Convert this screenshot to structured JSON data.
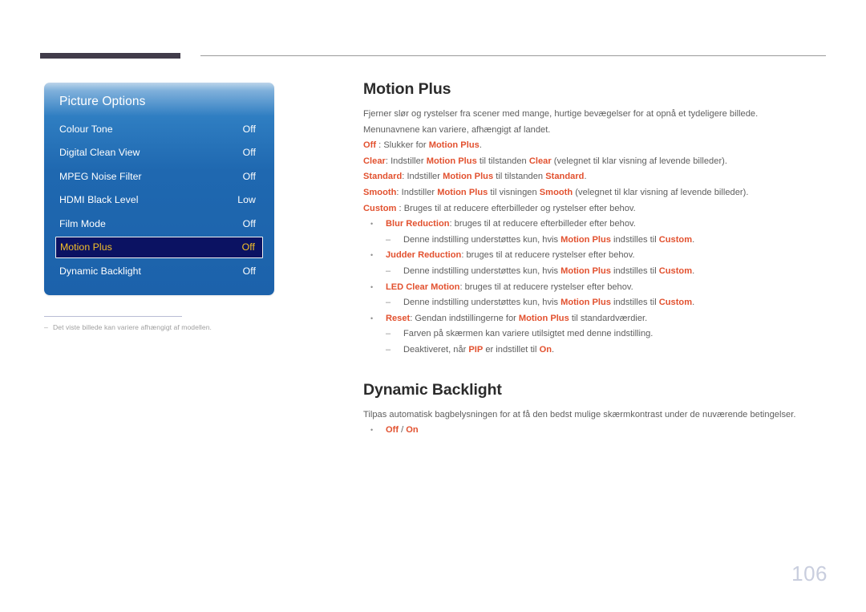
{
  "page": {
    "number": "106"
  },
  "osd": {
    "title": "Picture Options",
    "rows": [
      {
        "label": "Colour Tone",
        "value": "Off",
        "selected": false
      },
      {
        "label": "Digital Clean View",
        "value": "Off",
        "selected": false
      },
      {
        "label": "MPEG Noise Filter",
        "value": "Off",
        "selected": false
      },
      {
        "label": "HDMI Black Level",
        "value": "Low",
        "selected": false
      },
      {
        "label": "Film Mode",
        "value": "Off",
        "selected": false
      },
      {
        "label": "Motion Plus",
        "value": "Off",
        "selected": true
      },
      {
        "label": "Dynamic Backlight",
        "value": "Off",
        "selected": false
      }
    ],
    "accent_selected_text": "#f5c028",
    "accent_selected_bg": "#0b1262",
    "panel_blue": "#1f68b0"
  },
  "footnote": {
    "dash": "–",
    "text": "Det viste billede kan variere afhængigt af modellen."
  },
  "sections": [
    {
      "heading": "Motion Plus",
      "paragraphs": [
        {
          "segments": [
            {
              "t": "Fjerner slør og rystelser fra scener med mange, hurtige bevægelser for at opnå et tydeligere billede.",
              "s": "plain"
            }
          ]
        },
        {
          "segments": [
            {
              "t": "Menunavnene kan variere, afhængigt af landet.",
              "s": "plain"
            }
          ]
        },
        {
          "segments": [
            {
              "t": "Off",
              "s": "accent"
            },
            {
              "t": " : Slukker for ",
              "s": "plain"
            },
            {
              "t": "Motion Plus",
              "s": "accent"
            },
            {
              "t": ".",
              "s": "plain"
            }
          ]
        },
        {
          "segments": [
            {
              "t": "Clear",
              "s": "accent"
            },
            {
              "t": ": Indstiller ",
              "s": "plain"
            },
            {
              "t": "Motion Plus",
              "s": "accent"
            },
            {
              "t": " til tilstanden ",
              "s": "plain"
            },
            {
              "t": "Clear",
              "s": "accent"
            },
            {
              "t": " (velegnet til klar visning af levende billeder).",
              "s": "plain"
            }
          ]
        },
        {
          "segments": [
            {
              "t": "Standard",
              "s": "accent"
            },
            {
              "t": ": Indstiller ",
              "s": "plain"
            },
            {
              "t": "Motion Plus",
              "s": "accent"
            },
            {
              "t": " til tilstanden ",
              "s": "plain"
            },
            {
              "t": "Standard",
              "s": "accent"
            },
            {
              "t": ".",
              "s": "plain"
            }
          ]
        },
        {
          "segments": [
            {
              "t": "Smooth",
              "s": "accent"
            },
            {
              "t": ": Indstiller ",
              "s": "plain"
            },
            {
              "t": "Motion Plus",
              "s": "accent"
            },
            {
              "t": " til visningen ",
              "s": "plain"
            },
            {
              "t": "Smooth",
              "s": "accent"
            },
            {
              "t": " (velegnet til klar visning af levende billeder).",
              "s": "plain"
            }
          ]
        },
        {
          "segments": [
            {
              "t": "Custom",
              "s": "accent"
            },
            {
              "t": " : Bruges til at reducere efterbilleder og rystelser efter behov.",
              "s": "plain"
            }
          ]
        }
      ],
      "bullets": [
        {
          "level": 1,
          "segments": [
            {
              "t": "Blur Reduction",
              "s": "accent"
            },
            {
              "t": ": bruges til at reducere efterbilleder efter behov.",
              "s": "plain"
            }
          ]
        },
        {
          "level": 2,
          "segments": [
            {
              "t": "Denne indstilling understøttes kun, hvis ",
              "s": "plain"
            },
            {
              "t": "Motion Plus",
              "s": "accent"
            },
            {
              "t": " indstilles til ",
              "s": "plain"
            },
            {
              "t": "Custom",
              "s": "accent"
            },
            {
              "t": ".",
              "s": "plain"
            }
          ]
        },
        {
          "level": 1,
          "segments": [
            {
              "t": "Judder Reduction",
              "s": "accent"
            },
            {
              "t": ": bruges til at reducere rystelser efter behov.",
              "s": "plain"
            }
          ]
        },
        {
          "level": 2,
          "segments": [
            {
              "t": "Denne indstilling understøttes kun, hvis ",
              "s": "plain"
            },
            {
              "t": "Motion Plus",
              "s": "accent"
            },
            {
              "t": " indstilles til ",
              "s": "plain"
            },
            {
              "t": "Custom",
              "s": "accent"
            },
            {
              "t": ".",
              "s": "plain"
            }
          ]
        },
        {
          "level": 1,
          "segments": [
            {
              "t": "LED Clear Motion",
              "s": "accent"
            },
            {
              "t": ": bruges til at reducere rystelser efter behov.",
              "s": "plain"
            }
          ]
        },
        {
          "level": 2,
          "segments": [
            {
              "t": "Denne indstilling understøttes kun, hvis ",
              "s": "plain"
            },
            {
              "t": "Motion Plus",
              "s": "accent"
            },
            {
              "t": " indstilles til ",
              "s": "plain"
            },
            {
              "t": "Custom",
              "s": "accent"
            },
            {
              "t": ".",
              "s": "plain"
            }
          ]
        },
        {
          "level": 1,
          "segments": [
            {
              "t": "Reset",
              "s": "accent"
            },
            {
              "t": ": Gendan indstillingerne for ",
              "s": "plain"
            },
            {
              "t": "Motion Plus",
              "s": "accent"
            },
            {
              "t": " til standardværdier.",
              "s": "plain"
            }
          ]
        },
        {
          "level": 2,
          "segments": [
            {
              "t": "Farven på skærmen kan variere utilsigtet med denne indstilling.",
              "s": "plain"
            }
          ]
        },
        {
          "level": 2,
          "segments": [
            {
              "t": "Deaktiveret, når ",
              "s": "plain"
            },
            {
              "t": "PIP",
              "s": "accent"
            },
            {
              "t": " er indstillet til ",
              "s": "plain"
            },
            {
              "t": "On",
              "s": "accent"
            },
            {
              "t": ".",
              "s": "plain"
            }
          ]
        }
      ]
    },
    {
      "heading": "Dynamic Backlight",
      "paragraphs": [
        {
          "segments": [
            {
              "t": "Tilpas automatisk bagbelysningen for at få den bedst mulige skærmkontrast under de nuværende betingelser.",
              "s": "plain"
            }
          ]
        }
      ],
      "bullets": [
        {
          "level": 1,
          "segments": [
            {
              "t": "Off",
              "s": "accent"
            },
            {
              "t": " / ",
              "s": "plain"
            },
            {
              "t": "On",
              "s": "accent"
            }
          ]
        }
      ]
    }
  ],
  "colors": {
    "accent": "#e2512f",
    "body_text": "#5e5e5e",
    "heading": "#2b2b2b",
    "page_number": "#c9cede",
    "header_bar": "#413c4a"
  }
}
